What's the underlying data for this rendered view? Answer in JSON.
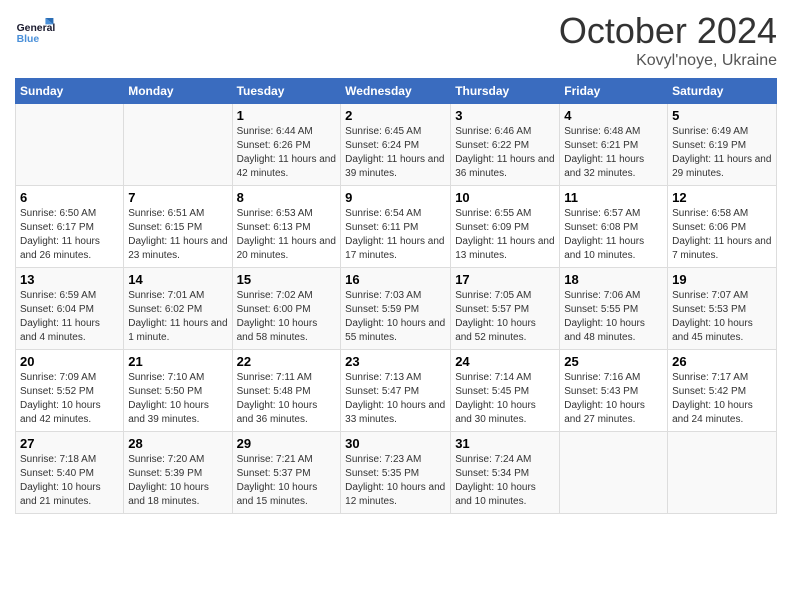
{
  "header": {
    "logo_general": "General",
    "logo_blue": "Blue",
    "month": "October 2024",
    "location": "Kovyl'noye, Ukraine"
  },
  "weekdays": [
    "Sunday",
    "Monday",
    "Tuesday",
    "Wednesday",
    "Thursday",
    "Friday",
    "Saturday"
  ],
  "weeks": [
    [
      null,
      null,
      {
        "day": 1,
        "sunrise": "6:44 AM",
        "sunset": "6:26 PM",
        "daylight": "11 hours and 42 minutes."
      },
      {
        "day": 2,
        "sunrise": "6:45 AM",
        "sunset": "6:24 PM",
        "daylight": "11 hours and 39 minutes."
      },
      {
        "day": 3,
        "sunrise": "6:46 AM",
        "sunset": "6:22 PM",
        "daylight": "11 hours and 36 minutes."
      },
      {
        "day": 4,
        "sunrise": "6:48 AM",
        "sunset": "6:21 PM",
        "daylight": "11 hours and 32 minutes."
      },
      {
        "day": 5,
        "sunrise": "6:49 AM",
        "sunset": "6:19 PM",
        "daylight": "11 hours and 29 minutes."
      }
    ],
    [
      {
        "day": 6,
        "sunrise": "6:50 AM",
        "sunset": "6:17 PM",
        "daylight": "11 hours and 26 minutes."
      },
      {
        "day": 7,
        "sunrise": "6:51 AM",
        "sunset": "6:15 PM",
        "daylight": "11 hours and 23 minutes."
      },
      {
        "day": 8,
        "sunrise": "6:53 AM",
        "sunset": "6:13 PM",
        "daylight": "11 hours and 20 minutes."
      },
      {
        "day": 9,
        "sunrise": "6:54 AM",
        "sunset": "6:11 PM",
        "daylight": "11 hours and 17 minutes."
      },
      {
        "day": 10,
        "sunrise": "6:55 AM",
        "sunset": "6:09 PM",
        "daylight": "11 hours and 13 minutes."
      },
      {
        "day": 11,
        "sunrise": "6:57 AM",
        "sunset": "6:08 PM",
        "daylight": "11 hours and 10 minutes."
      },
      {
        "day": 12,
        "sunrise": "6:58 AM",
        "sunset": "6:06 PM",
        "daylight": "11 hours and 7 minutes."
      }
    ],
    [
      {
        "day": 13,
        "sunrise": "6:59 AM",
        "sunset": "6:04 PM",
        "daylight": "11 hours and 4 minutes."
      },
      {
        "day": 14,
        "sunrise": "7:01 AM",
        "sunset": "6:02 PM",
        "daylight": "11 hours and 1 minute."
      },
      {
        "day": 15,
        "sunrise": "7:02 AM",
        "sunset": "6:00 PM",
        "daylight": "10 hours and 58 minutes."
      },
      {
        "day": 16,
        "sunrise": "7:03 AM",
        "sunset": "5:59 PM",
        "daylight": "10 hours and 55 minutes."
      },
      {
        "day": 17,
        "sunrise": "7:05 AM",
        "sunset": "5:57 PM",
        "daylight": "10 hours and 52 minutes."
      },
      {
        "day": 18,
        "sunrise": "7:06 AM",
        "sunset": "5:55 PM",
        "daylight": "10 hours and 48 minutes."
      },
      {
        "day": 19,
        "sunrise": "7:07 AM",
        "sunset": "5:53 PM",
        "daylight": "10 hours and 45 minutes."
      }
    ],
    [
      {
        "day": 20,
        "sunrise": "7:09 AM",
        "sunset": "5:52 PM",
        "daylight": "10 hours and 42 minutes."
      },
      {
        "day": 21,
        "sunrise": "7:10 AM",
        "sunset": "5:50 PM",
        "daylight": "10 hours and 39 minutes."
      },
      {
        "day": 22,
        "sunrise": "7:11 AM",
        "sunset": "5:48 PM",
        "daylight": "10 hours and 36 minutes."
      },
      {
        "day": 23,
        "sunrise": "7:13 AM",
        "sunset": "5:47 PM",
        "daylight": "10 hours and 33 minutes."
      },
      {
        "day": 24,
        "sunrise": "7:14 AM",
        "sunset": "5:45 PM",
        "daylight": "10 hours and 30 minutes."
      },
      {
        "day": 25,
        "sunrise": "7:16 AM",
        "sunset": "5:43 PM",
        "daylight": "10 hours and 27 minutes."
      },
      {
        "day": 26,
        "sunrise": "7:17 AM",
        "sunset": "5:42 PM",
        "daylight": "10 hours and 24 minutes."
      }
    ],
    [
      {
        "day": 27,
        "sunrise": "7:18 AM",
        "sunset": "5:40 PM",
        "daylight": "10 hours and 21 minutes."
      },
      {
        "day": 28,
        "sunrise": "7:20 AM",
        "sunset": "5:39 PM",
        "daylight": "10 hours and 18 minutes."
      },
      {
        "day": 29,
        "sunrise": "7:21 AM",
        "sunset": "5:37 PM",
        "daylight": "10 hours and 15 minutes."
      },
      {
        "day": 30,
        "sunrise": "7:23 AM",
        "sunset": "5:35 PM",
        "daylight": "10 hours and 12 minutes."
      },
      {
        "day": 31,
        "sunrise": "7:24 AM",
        "sunset": "5:34 PM",
        "daylight": "10 hours and 10 minutes."
      },
      null,
      null
    ]
  ]
}
